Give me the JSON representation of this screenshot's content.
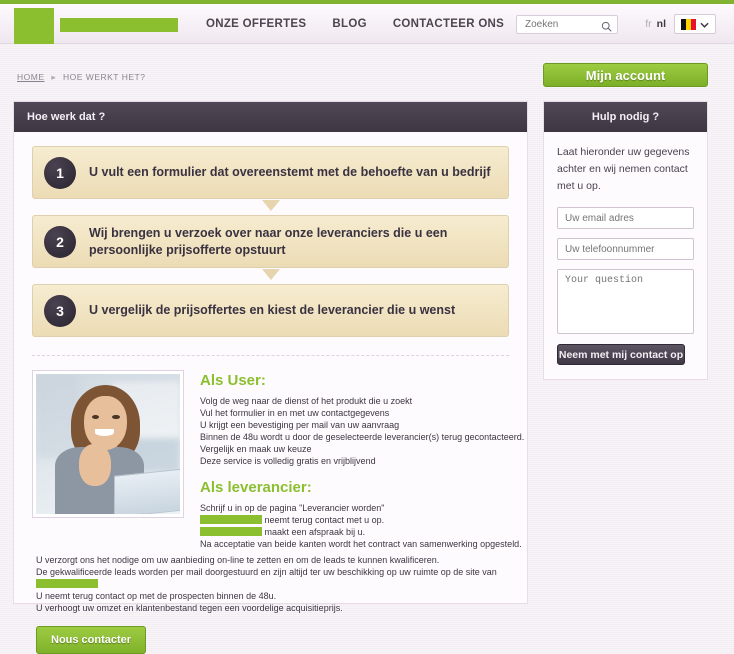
{
  "header": {
    "nav": [
      {
        "label": "ONZE OFFERTES"
      },
      {
        "label": "BLOG"
      },
      {
        "label": "CONTACTEER ONS"
      }
    ],
    "search": {
      "placeholder": "Zoeken",
      "value": "",
      "icon": "search-icon"
    },
    "lang": {
      "inactive": "fr",
      "active": "nl"
    },
    "flag": {
      "name": "belgium-flag",
      "colors": [
        "#101010",
        "#ffd500",
        "#e8112d"
      ]
    },
    "logo_color": "#8cbf2f"
  },
  "breadcrumb": {
    "home": "HOME",
    "separator": "▸",
    "current": "HOE WERKT HET?"
  },
  "main": {
    "panel_title": "Hoe werk dat ?",
    "steps": [
      {
        "num": "1",
        "text": "U vult een formulier dat overeenstemt met de behoefte van u bedrijf"
      },
      {
        "num": "2",
        "text": "Wij brengen u verzoek over naar onze leveranciers die u een persoonlijke prijsofferte opstuurt"
      },
      {
        "num": "3",
        "text": "U vergelijk de prijsoffertes en kiest de leverancier die u wenst"
      }
    ],
    "photo": {
      "name": "woman-with-laptop-photo"
    },
    "user_section": {
      "heading": "Als User:",
      "lines": [
        "Volg de weg naar de dienst of het produkt die u zoekt",
        "Vul het formulier in en met uw contactgegevens",
        "U krijgt een bevestiging per mail van uw aanvraag",
        "Binnen de 48u wordt u door de geselecteerde leverancier(s) terug gecontacteerd.",
        "Vergelijk en maak uw keuze",
        "Deze service is volledig gratis en vrijblijvend"
      ]
    },
    "supplier_section": {
      "heading": "Als leverancier:",
      "line1": "Schrijf u in op de pagina \"Leverancier worden\"",
      "line2_after": "neemt terug contact met u op.",
      "line3_after": "maakt een afspraak bij u.",
      "line4": "Na acceptatie van beide kanten wordt het contract van samenwerking opgesteld."
    },
    "wide_lines": {
      "l1": "U verzorgt ons het nodige om uw aanbieding on-line te zetten en om de leads te kunnen kwalificeren.",
      "l2": "De gekwalificeerde leads worden per mail doorgestuurd en zijn altijd ter uw beschikking op uw ruimte op de site van",
      "l3": "U neemt terug contact op met de prospecten binnen de 48u.",
      "l4": "U verhoogt uw omzet en klantenbestand tegen een voordelige acquisitieprijs."
    },
    "contact_button": "Nous contacter"
  },
  "sidebar": {
    "account_button": "Mijn account",
    "help_title": "Hulp nodig ?",
    "help_intro": "Laat hieronder uw gegevens achter en wij nemen contact met u op.",
    "email_placeholder": "Uw email adres",
    "email_value": "",
    "phone_placeholder": "Uw telefoonnummer",
    "phone_value": "",
    "question_placeholder": "Your question",
    "question_value": "",
    "submit_button": "Neem met mij contact op"
  },
  "colors": {
    "accent_green": "#8cbf2f",
    "panel_dark": "#3e3643",
    "step_bg": "#f0e0bb",
    "page_bg": "#f2ecf2"
  }
}
